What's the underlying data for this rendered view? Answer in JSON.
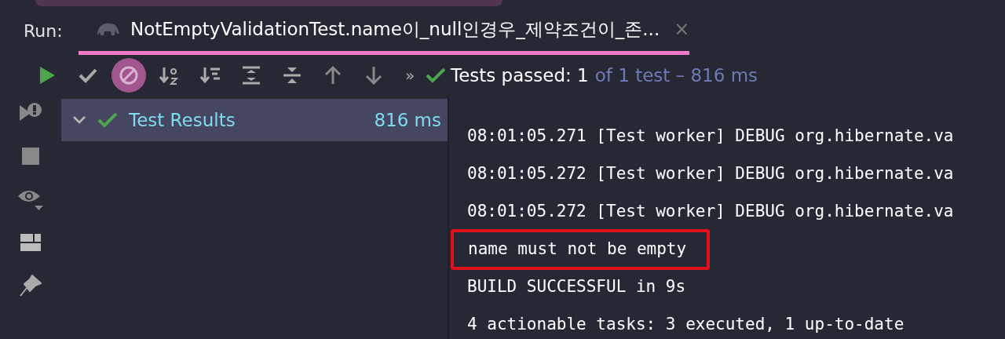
{
  "run_label": "Run:",
  "tab": {
    "title": "NotEmptyValidationTest.name이_null인경우_제약조건이_존...",
    "close": "×",
    "selected": true
  },
  "toolbar": {
    "toggles": [
      {
        "kind": "passed",
        "on": false
      },
      {
        "kind": "ignored",
        "on": true
      }
    ],
    "more": "»",
    "status": "Tests passed: 1",
    "detail": "of 1 test – 816 ms"
  },
  "tree": [
    {
      "label": "Test Results",
      "duration": "816 ms",
      "expanded": true,
      "selected": true,
      "passed": true
    }
  ],
  "console": [
    {
      "text": "08:01:05.271 [Test worker] DEBUG org.hibernate.va",
      "highlighted": false
    },
    {
      "text": "08:01:05.272 [Test worker] DEBUG org.hibernate.va",
      "highlighted": false
    },
    {
      "text": "08:01:05.272 [Test worker] DEBUG org.hibernate.va",
      "highlighted": false
    },
    {
      "text": "name must not be empty",
      "highlighted": true
    },
    {
      "text": "BUILD SUCCESSFUL in 9s",
      "highlighted": false
    },
    {
      "text": "4 actionable tasks: 3 executed, 1 up-to-date",
      "highlighted": false
    }
  ]
}
